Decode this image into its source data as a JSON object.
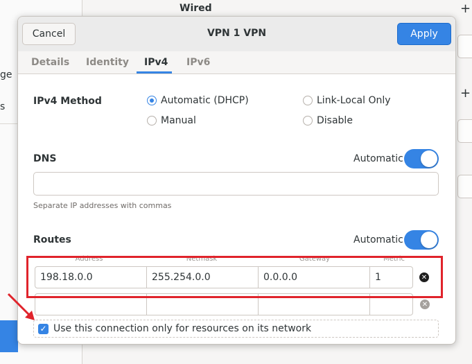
{
  "background": {
    "header_title": "Wired",
    "sidebar_fragments": [
      "ge",
      "s"
    ]
  },
  "dialog": {
    "title": "VPN 1 VPN",
    "cancel_label": "Cancel",
    "apply_label": "Apply"
  },
  "tabs": [
    {
      "label": "Details",
      "active": false
    },
    {
      "label": "Identity",
      "active": false
    },
    {
      "label": "IPv4",
      "active": true
    },
    {
      "label": "IPv6",
      "active": false
    }
  ],
  "ipv4": {
    "method_label": "IPv4 Method",
    "methods": [
      {
        "label": "Automatic (DHCP)",
        "selected": true
      },
      {
        "label": "Link-Local Only",
        "selected": false
      },
      {
        "label": "Manual",
        "selected": false
      },
      {
        "label": "Disable",
        "selected": false
      }
    ],
    "dns_label": "DNS",
    "dns_auto_label": "Automatic",
    "dns_auto_on": true,
    "dns_value": "",
    "dns_hint": "Separate IP addresses with commas",
    "routes_label": "Routes",
    "routes_auto_label": "Automatic",
    "routes_auto_on": true,
    "route_columns": [
      "Address",
      "Netmask",
      "Gateway",
      "Metric"
    ],
    "routes": [
      {
        "address": "198.18.0.0",
        "netmask": "255.254.0.0",
        "gateway": "0.0.0.0",
        "metric": "1"
      },
      {
        "address": "",
        "netmask": "",
        "gateway": "",
        "metric": ""
      }
    ],
    "only_resources_label": "Use this connection only for resources on its network",
    "only_resources_checked": true
  },
  "colors": {
    "accent": "#3584e4",
    "highlight": "#e0232b"
  },
  "icons": {
    "delete_route": "close-circle-icon",
    "annotation_arrow": "red-arrow-icon"
  }
}
